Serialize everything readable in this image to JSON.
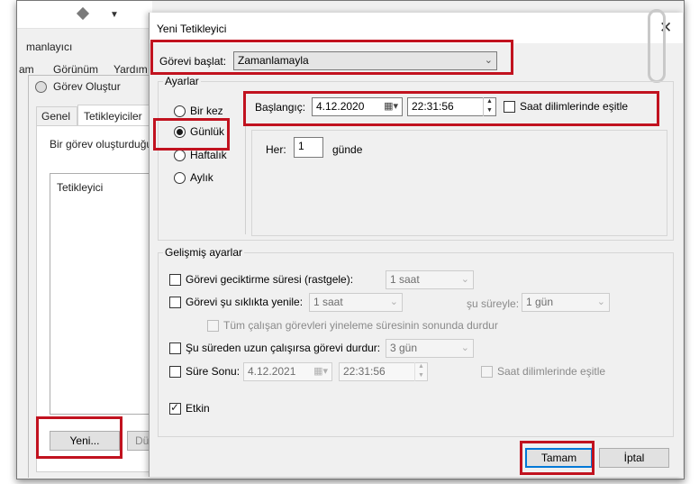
{
  "background": {
    "app_subtitle": "manlayıcı",
    "menu_items": [
      "am",
      "Görünüm",
      "Yardım"
    ],
    "dialog_title": "Görev Oluştur",
    "tabs": [
      "Genel",
      "Tetikleyiciler"
    ],
    "description": "Bir görev oluşturduğu",
    "list_header": "Tetikleyici",
    "new_button": "Yeni...",
    "edit_button_partial": "Dü"
  },
  "dialog": {
    "title": "Yeni Tetikleyici",
    "close_icon": "close-icon",
    "begin_task_label": "Görevi başlat:",
    "begin_task_value": "Zamanlamayla",
    "settings_group": "Ayarlar",
    "schedule_options": [
      {
        "label": "Bir kez",
        "selected": false
      },
      {
        "label": "Günlük",
        "selected": true
      },
      {
        "label": "Haftalık",
        "selected": false
      },
      {
        "label": "Aylık",
        "selected": false
      }
    ],
    "start_label": "Başlangıç:",
    "start_date": "4.12.2020",
    "start_time": "22:31:56",
    "sync_tz_label": "Saat dilimlerinde eşitle",
    "recur_every_label": "Her:",
    "recur_every_value": "1",
    "recur_unit": "günde",
    "advanced_group": "Gelişmiş ayarlar",
    "delay_label": "Görevi geciktirme süresi (rastgele):",
    "delay_value": "1 saat",
    "repeat_label": "Görevi şu sıklıkta yenile:",
    "repeat_value": "1 saat",
    "duration_label": "şu süreyle:",
    "duration_value": "1 gün",
    "stop_all_label": "Tüm çalışan görevleri yineleme süresinin sonunda durdur",
    "stop_longer_label": "Şu süreden uzun çalışırsa görevi durdur:",
    "stop_longer_value": "3 gün",
    "expire_label": "Süre Sonu:",
    "expire_date": "4.12.2021",
    "expire_time": "22:31:56",
    "expire_sync_label": "Saat dilimlerinde eşitle",
    "enabled_label": "Etkin",
    "enabled": true,
    "ok_button": "Tamam",
    "cancel_button": "İptal"
  },
  "colors": {
    "highlight": "#c1121f",
    "focus": "#0078d7",
    "window_bg": "#f0f0f0"
  }
}
